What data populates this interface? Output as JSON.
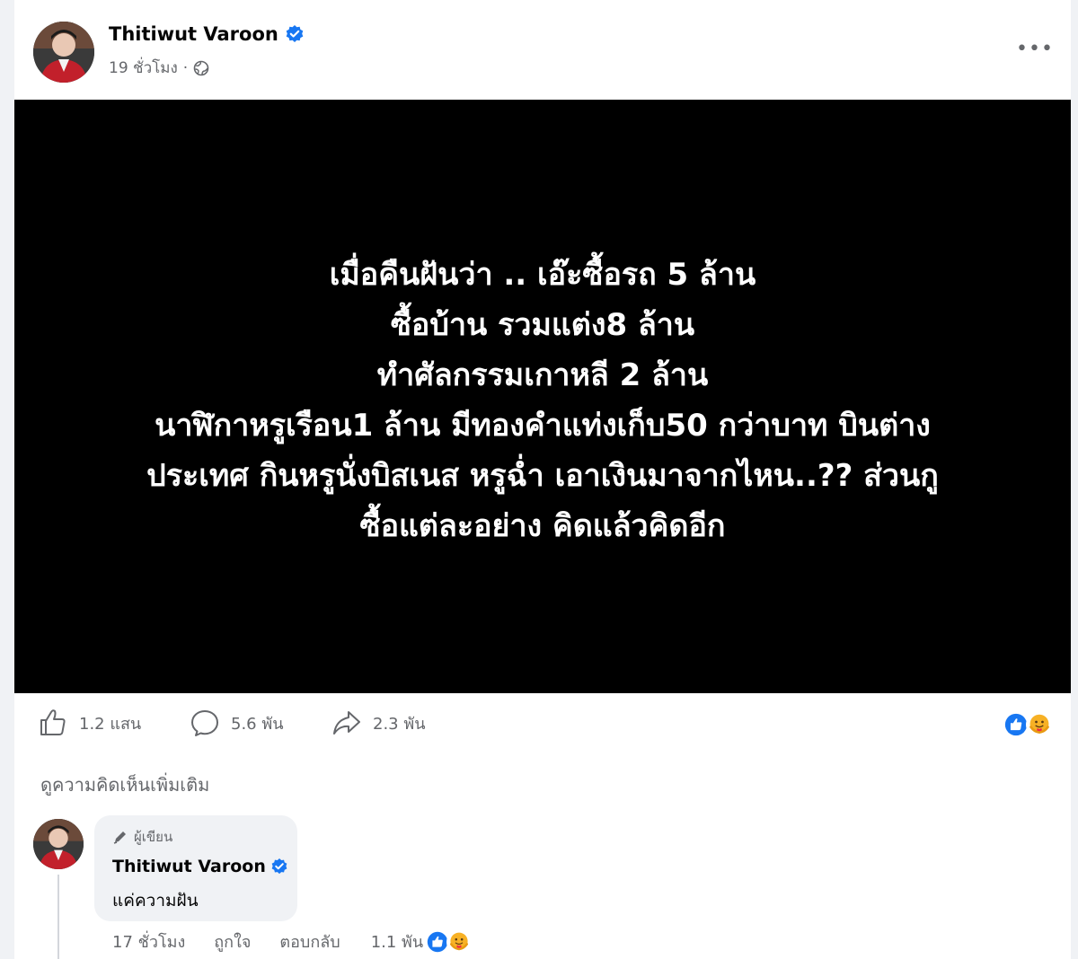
{
  "post": {
    "author": "Thitiwut Varoon",
    "timestamp": "19 ชั่วโมง",
    "separator": "·",
    "privacy_icon": "globe-icon",
    "more_icon": "more-horizontal-icon",
    "more_label": "•••"
  },
  "image_text": {
    "lines": [
      "เมื่อคืนฝันว่า .. เอ๊ะซื้อรถ 5 ล้าน",
      "ซื้อบ้าน รวมแต่ง8 ล้าน",
      "ทำศัลกรรมเกาหลี 2 ล้าน",
      "นาฬิกาหรูเรือน1 ล้าน มีทองคำแท่งเก็บ50 กว่าบาท บินต่าง",
      "ประเทศ กินหรูนั่งบิสเนส หรูฉ่ำ เอาเงินมาจากไหน..?? ส่วนกู",
      "ซื้อแต่ละอย่าง คิดแล้วคิดอีก"
    ]
  },
  "actions": {
    "likes": "1.2 แสน",
    "comments": "5.6 พัน",
    "shares": "2.3 พัน"
  },
  "reactions": [
    "like-reaction-icon",
    "care-reaction-icon"
  ],
  "more_comments": "ดูความคิดเห็นเพิ่มเติม",
  "comment": {
    "badge": "ผู้เขียน",
    "author": "Thitiwut Varoon",
    "text": "แค่ความฝัน",
    "timestamp": "17 ชั่วโมง",
    "like_label": "ถูกใจ",
    "reply_label": "ตอบกลับ",
    "reaction_count": "1.1 พัน"
  },
  "colors": {
    "verified": "#1877f2",
    "secondary_text": "#65676b",
    "media_background": "#000000"
  }
}
